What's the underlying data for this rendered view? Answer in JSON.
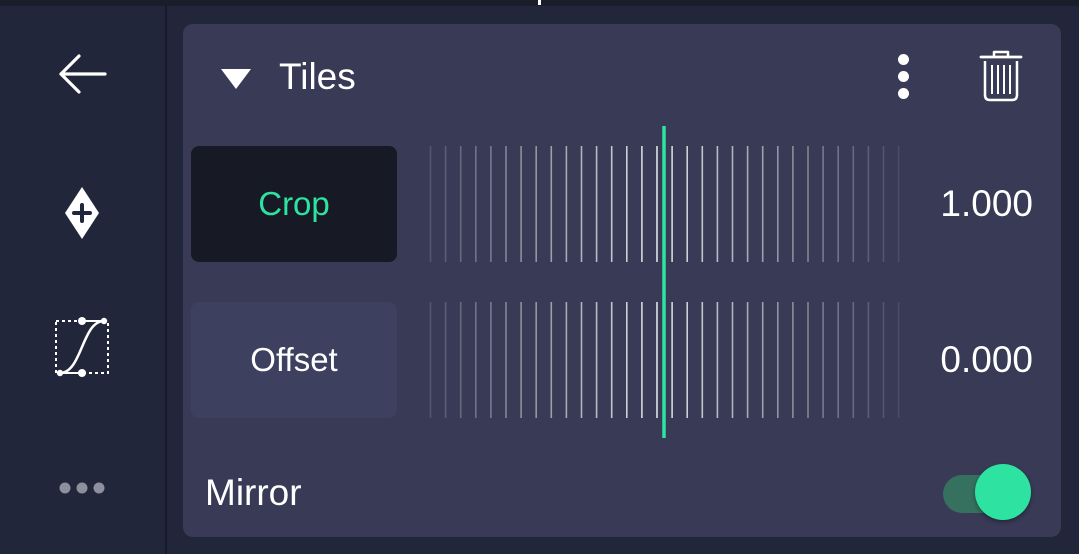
{
  "sidebar": {
    "items": [
      {
        "icon": "back-arrow-icon"
      },
      {
        "icon": "add-keyframe-icon"
      },
      {
        "icon": "easing-curve-icon"
      },
      {
        "icon": "more-horizontal-icon"
      }
    ]
  },
  "panel": {
    "title": "Tiles",
    "expanded": true,
    "params": [
      {
        "label": "Crop",
        "value": "1.000",
        "selected": true
      },
      {
        "label": "Offset",
        "value": "0.000",
        "selected": false
      }
    ],
    "mirror": {
      "label": "Mirror",
      "enabled": true
    }
  },
  "colors": {
    "accent": "#2ee3a2",
    "panel_bg": "#383a56",
    "sidebar_bg": "#22263a",
    "selected_label_bg": "#171a24",
    "toggle_track_on": "#36705e"
  }
}
